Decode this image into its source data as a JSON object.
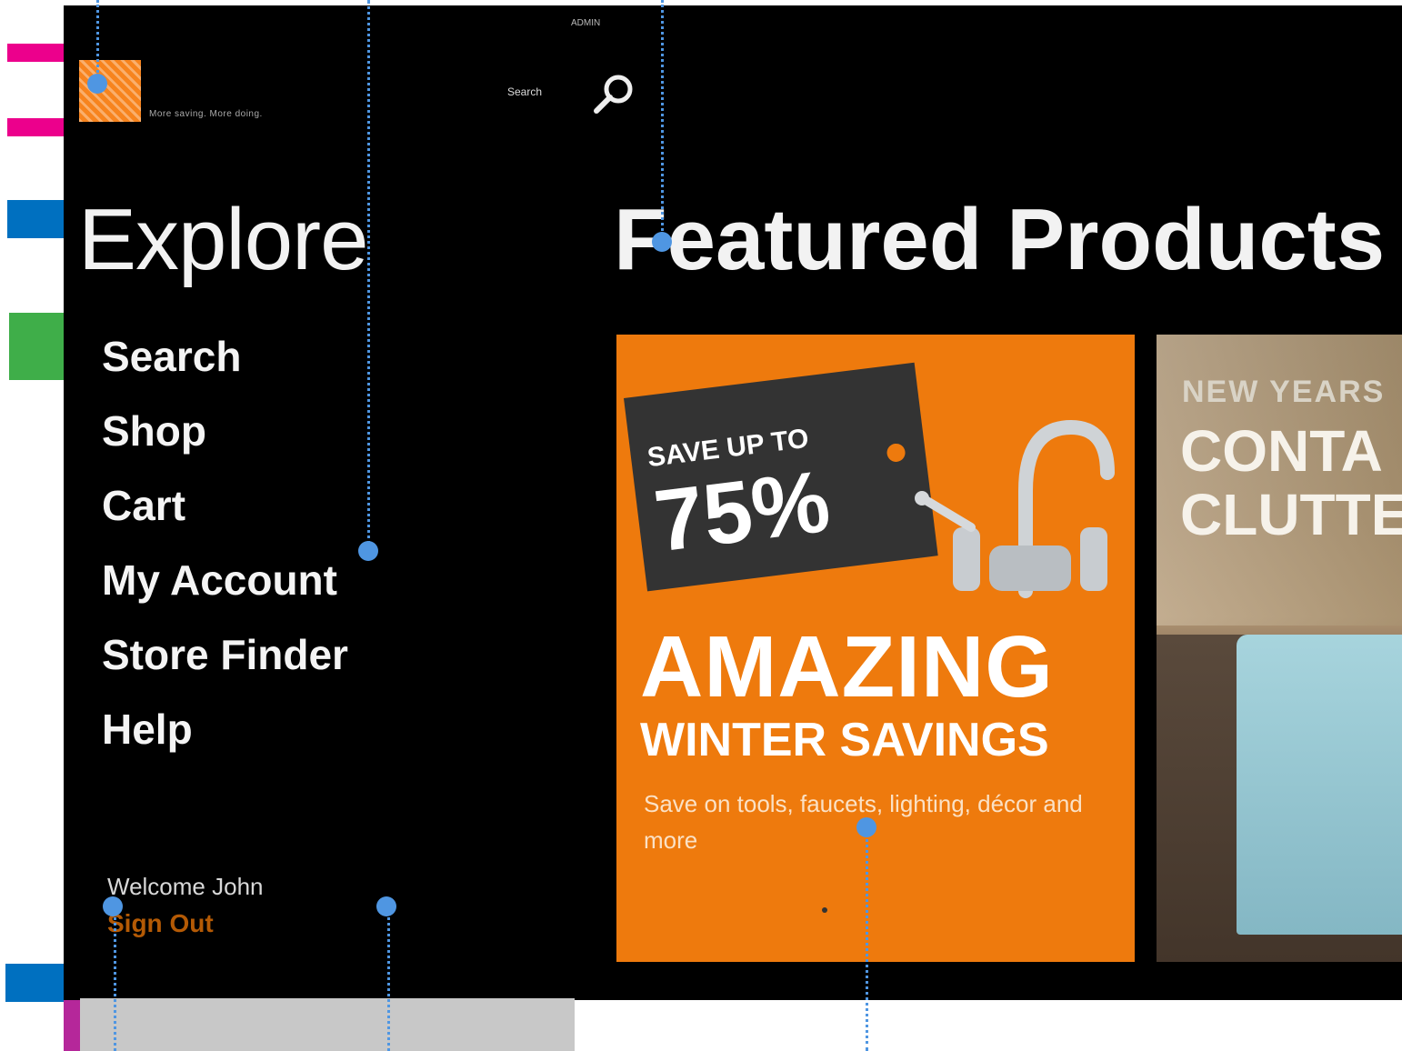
{
  "header": {
    "top_label": "ADMIN",
    "tagline": "More saving. More doing.",
    "search_label": "Search"
  },
  "explore": {
    "title": "Explore",
    "nav": [
      "Search",
      "Shop",
      "Cart",
      "My Account",
      "Store Finder",
      "Help"
    ],
    "welcome": "Welcome John",
    "sign_out": "Sign Out"
  },
  "featured": {
    "title": "Featured Products",
    "tiles": [
      {
        "tag_pre": "SAVE UP TO",
        "tag_value": "75%",
        "headline": "AMAZING",
        "subhead": "WINTER SAVINGS",
        "description": "Save on tools, faucets, lighting, décor and more"
      },
      {
        "line1": "NEW YEARS",
        "line2": "CONTA",
        "line3": "CLUTTE"
      }
    ]
  },
  "colors": {
    "brand_orange": "#ee7a0d",
    "sign_out": "#b45a05",
    "annotation": "#4f96e2"
  }
}
